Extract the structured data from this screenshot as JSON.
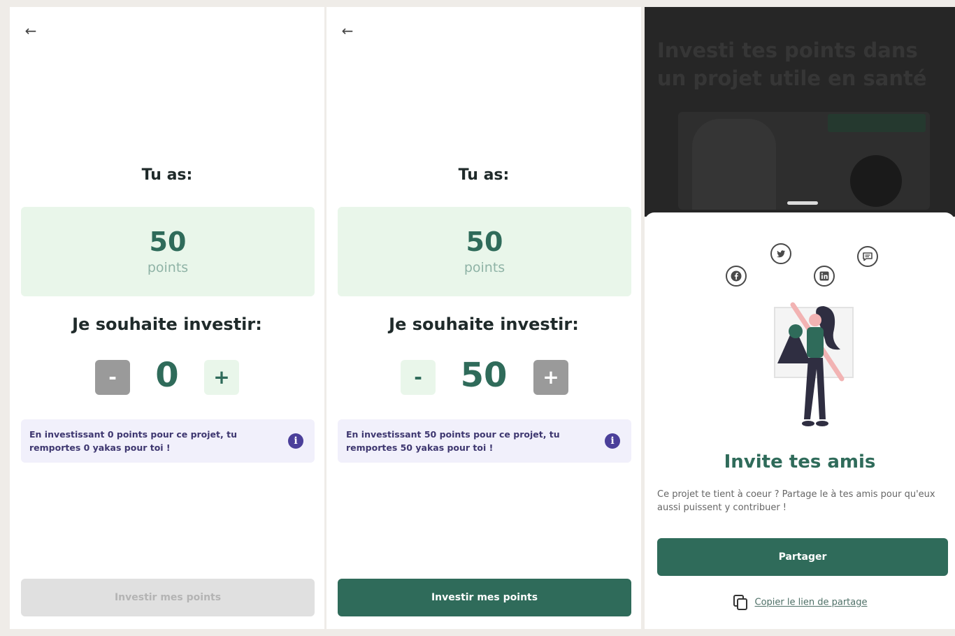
{
  "icons": {
    "back": "arrow-left-icon",
    "info": "info-icon",
    "facebook": "facebook-icon",
    "twitter": "twitter-icon",
    "linkedin": "linkedin-icon",
    "message": "message-icon",
    "copy": "copy-icon"
  },
  "colors": {
    "primary": "#2f6b5a",
    "points_card_bg": "#e9f6ea",
    "info_bg": "#f1f0fb",
    "info_accent": "#4b3f9a",
    "disabled_bg": "#e0e0e0"
  },
  "screen1": {
    "back_glyph": "←",
    "you_have_label": "Tu as:",
    "points_value": "50",
    "points_unit": "points",
    "invest_label": "Je souhaite investir:",
    "stepper": {
      "minus": "-",
      "value": "0",
      "plus": "+"
    },
    "info_text": "En investissant 0 points pour ce projet, tu remportes 0 yakas pour toi !",
    "info_glyph": "i",
    "cta_label": "Investir mes points",
    "cta_enabled": false
  },
  "screen2": {
    "back_glyph": "←",
    "you_have_label": "Tu as:",
    "points_value": "50",
    "points_unit": "points",
    "invest_label": "Je souhaite investir:",
    "stepper": {
      "minus": "-",
      "value": "50",
      "plus": "+"
    },
    "info_text": "En investissant 50 points pour ce projet, tu remportes 50 yakas pour toi !",
    "info_glyph": "i",
    "cta_label": "Investir mes points",
    "cta_enabled": true
  },
  "screen3": {
    "background_title": "Investi tes points dans un projet utile en santé",
    "share_sheet": {
      "title": "Invite tes amis",
      "description": "Ce projet te tient à coeur ? Partage le à tes amis pour qu'eux aussi puissent y contribuer !",
      "share_button": "Partager",
      "copy_link": "Copier le lien de partage"
    }
  }
}
